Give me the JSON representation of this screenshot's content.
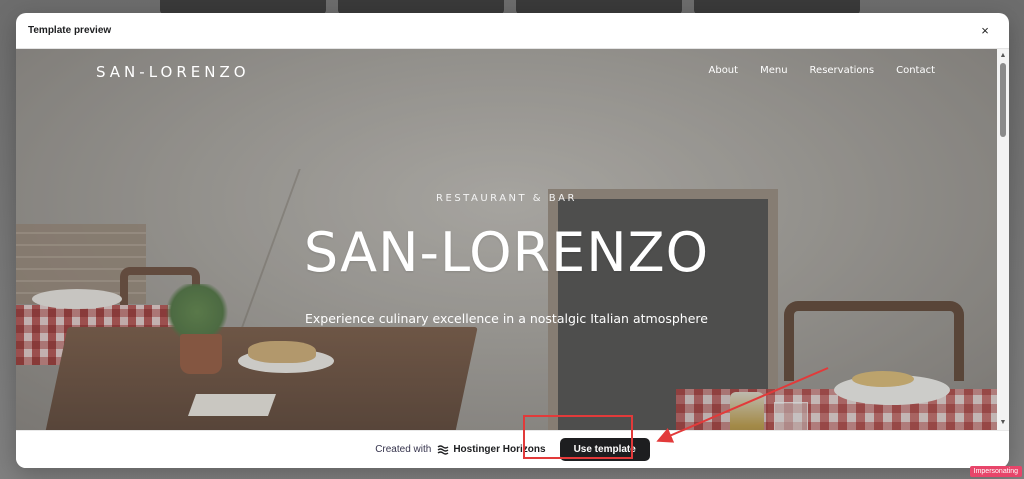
{
  "modal": {
    "title": "Template preview",
    "close_icon": "×"
  },
  "site": {
    "logo": "SAN-LORENZO",
    "nav": [
      "About",
      "Menu",
      "Reservations",
      "Contact"
    ],
    "hero_kicker": "RESTAURANT & BAR",
    "hero_title": "SAN-LORENZO",
    "hero_subtitle": "Experience culinary excellence in a nostalgic Italian atmosphere"
  },
  "footer": {
    "created_with": "Created with",
    "brand_name": "Hostinger Horizons",
    "use_template_label": "Use template"
  },
  "annotation": {
    "color": "#e23a3a"
  },
  "badge": {
    "label": "Impersonating",
    "color": "#e8456a"
  }
}
